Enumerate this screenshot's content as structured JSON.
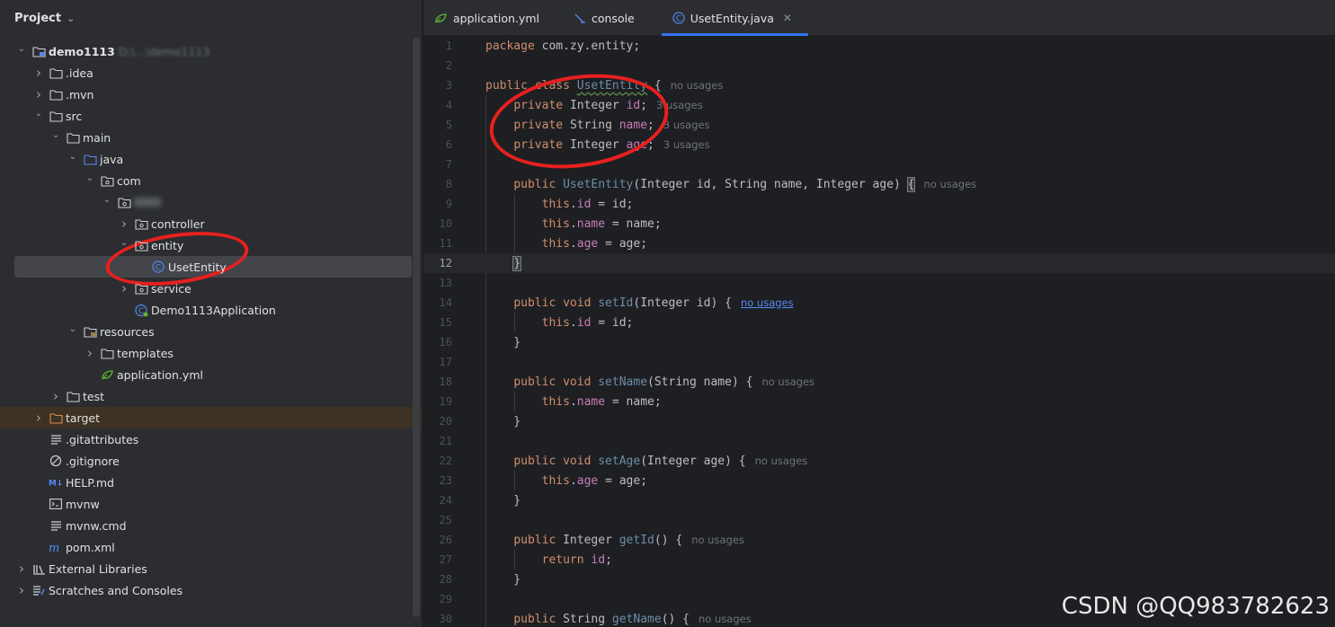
{
  "project_panel": {
    "title": "Project",
    "tree": [
      {
        "label": "demo1113",
        "path": "D:\\...\\demo1113",
        "indent": 0,
        "arrow": "v",
        "icon": "module-folder-icon",
        "bold": true
      },
      {
        "label": ".idea",
        "indent": 1,
        "arrow": ">",
        "icon": "folder-icon"
      },
      {
        "label": ".mvn",
        "indent": 1,
        "arrow": ">",
        "icon": "folder-icon"
      },
      {
        "label": "src",
        "indent": 1,
        "arrow": "v",
        "icon": "folder-icon"
      },
      {
        "label": "main",
        "indent": 2,
        "arrow": "v",
        "icon": "folder-icon"
      },
      {
        "label": "java",
        "indent": 3,
        "arrow": "v",
        "icon": "source-folder-icon"
      },
      {
        "label": "com",
        "indent": 4,
        "arrow": "v",
        "icon": "package-icon"
      },
      {
        "label": "",
        "indent": 5,
        "arrow": "v",
        "icon": "package-icon",
        "blurred": true
      },
      {
        "label": "controller",
        "indent": 6,
        "arrow": ">",
        "icon": "package-icon"
      },
      {
        "label": "entity",
        "indent": 6,
        "arrow": "v",
        "icon": "package-icon"
      },
      {
        "label": "UsetEntity",
        "indent": 7,
        "arrow": "",
        "icon": "class-icon",
        "selected": true
      },
      {
        "label": "service",
        "indent": 6,
        "arrow": ">",
        "icon": "package-icon"
      },
      {
        "label": "Demo1113Application",
        "indent": 6,
        "arrow": "",
        "icon": "spring-class-icon"
      },
      {
        "label": "resources",
        "indent": 3,
        "arrow": "v",
        "icon": "resources-folder-icon"
      },
      {
        "label": "templates",
        "indent": 4,
        "arrow": ">",
        "icon": "folder-icon"
      },
      {
        "label": "application.yml",
        "indent": 4,
        "arrow": "",
        "icon": "spring-yml-icon"
      },
      {
        "label": "test",
        "indent": 2,
        "arrow": ">",
        "icon": "folder-icon"
      },
      {
        "label": "target",
        "indent": 1,
        "arrow": ">",
        "icon": "excluded-folder-icon",
        "highlight": true
      },
      {
        "label": ".gitattributes",
        "indent": 1,
        "arrow": "",
        "icon": "text-file-icon"
      },
      {
        "label": ".gitignore",
        "indent": 1,
        "arrow": "",
        "icon": "ignore-file-icon"
      },
      {
        "label": "HELP.md",
        "indent": 1,
        "arrow": "",
        "icon": "markdown-icon"
      },
      {
        "label": "mvnw",
        "indent": 1,
        "arrow": "",
        "icon": "shell-script-icon"
      },
      {
        "label": "mvnw.cmd",
        "indent": 1,
        "arrow": "",
        "icon": "text-file-icon"
      },
      {
        "label": "pom.xml",
        "indent": 1,
        "arrow": "",
        "icon": "maven-icon"
      },
      {
        "label": "External Libraries",
        "indent": 0,
        "arrow": ">",
        "icon": "libraries-icon"
      },
      {
        "label": "Scratches and Consoles",
        "indent": 0,
        "arrow": ">",
        "icon": "scratches-icon"
      }
    ]
  },
  "tabs": [
    {
      "label": "application.yml",
      "icon": "spring-yml-icon",
      "active": false
    },
    {
      "label": "console",
      "icon": "console-icon",
      "active": false
    },
    {
      "label": "UsetEntity.java",
      "icon": "class-icon",
      "active": true,
      "closable": true
    }
  ],
  "editor": {
    "current_line": 12,
    "lines": [
      {
        "n": 1,
        "seg": [
          [
            "kw",
            "package "
          ],
          [
            "",
            "com.zy.entity;"
          ]
        ]
      },
      {
        "n": 2,
        "seg": []
      },
      {
        "n": 3,
        "seg": [
          [
            "kw",
            "public class "
          ],
          [
            "cls-unused",
            "UsetEntity"
          ],
          [
            "",
            " {"
          ]
        ],
        "hint": "no usages"
      },
      {
        "n": 4,
        "seg": [
          [
            "",
            "    "
          ],
          [
            "kw",
            "private "
          ],
          [
            "",
            "Integer "
          ],
          [
            "fld",
            "id"
          ],
          [
            "",
            ";"
          ]
        ],
        "hint": "3 usages"
      },
      {
        "n": 5,
        "seg": [
          [
            "",
            "    "
          ],
          [
            "kw",
            "private "
          ],
          [
            "",
            "String "
          ],
          [
            "fld",
            "name"
          ],
          [
            "",
            ";"
          ]
        ],
        "hint": "3 usages"
      },
      {
        "n": 6,
        "seg": [
          [
            "",
            "    "
          ],
          [
            "kw",
            "private "
          ],
          [
            "",
            "Integer "
          ],
          [
            "fld",
            "age"
          ],
          [
            "",
            ";"
          ]
        ],
        "hint": "3 usages"
      },
      {
        "n": 7,
        "seg": []
      },
      {
        "n": 8,
        "seg": [
          [
            "",
            "    "
          ],
          [
            "kw",
            "public "
          ],
          [
            "fn-unused",
            "UsetEntity"
          ],
          [
            "",
            "(Integer id, String name, Integer age) "
          ],
          [
            "brace",
            "{"
          ]
        ],
        "hint": "no usages"
      },
      {
        "n": 9,
        "seg": [
          [
            "",
            "        "
          ],
          [
            "kw",
            "this"
          ],
          [
            "",
            "."
          ],
          [
            "fld",
            "id"
          ],
          [
            "",
            " = id;"
          ]
        ]
      },
      {
        "n": 10,
        "seg": [
          [
            "",
            "        "
          ],
          [
            "kw",
            "this"
          ],
          [
            "",
            "."
          ],
          [
            "fld",
            "name"
          ],
          [
            "",
            " = name;"
          ]
        ]
      },
      {
        "n": 11,
        "seg": [
          [
            "",
            "        "
          ],
          [
            "kw",
            "this"
          ],
          [
            "",
            "."
          ],
          [
            "fld",
            "age"
          ],
          [
            "",
            " = age;"
          ]
        ]
      },
      {
        "n": 12,
        "seg": [
          [
            "",
            "    "
          ],
          [
            "brace",
            "}"
          ]
        ]
      },
      {
        "n": 13,
        "seg": []
      },
      {
        "n": 14,
        "seg": [
          [
            "",
            "    "
          ],
          [
            "kw",
            "public void "
          ],
          [
            "fn-unused",
            "setId"
          ],
          [
            "",
            "(Integer id) {"
          ]
        ],
        "hint": "no usages",
        "hint_link": true
      },
      {
        "n": 15,
        "seg": [
          [
            "",
            "        "
          ],
          [
            "kw",
            "this"
          ],
          [
            "",
            "."
          ],
          [
            "fld",
            "id"
          ],
          [
            "",
            " = id;"
          ]
        ]
      },
      {
        "n": 16,
        "seg": [
          [
            "",
            "    }"
          ]
        ]
      },
      {
        "n": 17,
        "seg": []
      },
      {
        "n": 18,
        "seg": [
          [
            "",
            "    "
          ],
          [
            "kw",
            "public void "
          ],
          [
            "fn-unused",
            "setName"
          ],
          [
            "",
            "(String name) {"
          ]
        ],
        "hint": "no usages"
      },
      {
        "n": 19,
        "seg": [
          [
            "",
            "        "
          ],
          [
            "kw",
            "this"
          ],
          [
            "",
            "."
          ],
          [
            "fld",
            "name"
          ],
          [
            "",
            " = name;"
          ]
        ]
      },
      {
        "n": 20,
        "seg": [
          [
            "",
            "    }"
          ]
        ]
      },
      {
        "n": 21,
        "seg": []
      },
      {
        "n": 22,
        "seg": [
          [
            "",
            "    "
          ],
          [
            "kw",
            "public void "
          ],
          [
            "fn-unused",
            "setAge"
          ],
          [
            "",
            "(Integer age) {"
          ]
        ],
        "hint": "no usages"
      },
      {
        "n": 23,
        "seg": [
          [
            "",
            "        "
          ],
          [
            "kw",
            "this"
          ],
          [
            "",
            "."
          ],
          [
            "fld",
            "age"
          ],
          [
            "",
            " = age;"
          ]
        ]
      },
      {
        "n": 24,
        "seg": [
          [
            "",
            "    }"
          ]
        ]
      },
      {
        "n": 25,
        "seg": []
      },
      {
        "n": 26,
        "seg": [
          [
            "",
            "    "
          ],
          [
            "kw",
            "public "
          ],
          [
            "",
            "Integer "
          ],
          [
            "fn-unused",
            "getId"
          ],
          [
            "",
            "() {"
          ]
        ],
        "hint": "no usages"
      },
      {
        "n": 27,
        "seg": [
          [
            "",
            "        "
          ],
          [
            "kw",
            "return "
          ],
          [
            "fld",
            "id"
          ],
          [
            "",
            ";"
          ]
        ]
      },
      {
        "n": 28,
        "seg": [
          [
            "",
            "    }"
          ]
        ]
      },
      {
        "n": 29,
        "seg": []
      },
      {
        "n": 30,
        "seg": [
          [
            "",
            "    "
          ],
          [
            "kw",
            "public "
          ],
          [
            "",
            "String "
          ],
          [
            "fn-unused",
            "getName"
          ],
          [
            "",
            "() {"
          ]
        ],
        "hint": "no usages"
      }
    ]
  },
  "watermark": "CSDN @QQ983782623",
  "colors": {
    "annotation_red": "#e8201f",
    "accent": "#3574f0"
  }
}
